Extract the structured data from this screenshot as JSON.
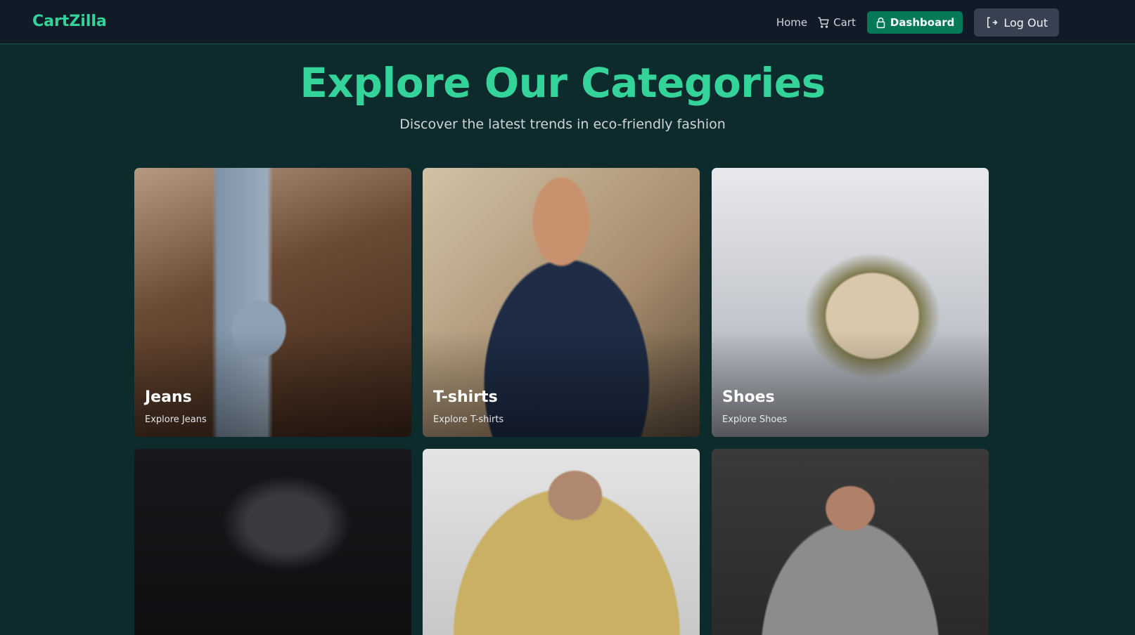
{
  "nav": {
    "logo": "CartZilla",
    "home": "Home",
    "cart": "Cart",
    "dashboard": "Dashboard",
    "logout": "Log Out"
  },
  "hero": {
    "title": "Explore Our Categories",
    "subtitle": "Discover the latest trends in eco-friendly fashion"
  },
  "categories": [
    {
      "title": "Jeans",
      "link": "Explore Jeans"
    },
    {
      "title": "T-shirts",
      "link": "Explore T-shirts"
    },
    {
      "title": "Shoes",
      "link": "Explore Shoes"
    },
    {
      "title": "",
      "link": ""
    },
    {
      "title": "",
      "link": ""
    },
    {
      "title": "",
      "link": ""
    }
  ]
}
